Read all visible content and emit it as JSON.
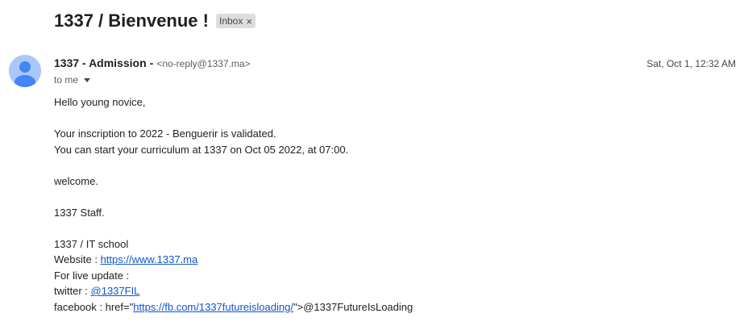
{
  "email": {
    "subject": "1337 / Bienvenue !",
    "label_chip": "Inbox",
    "label_chip_close": "×",
    "sender_name": "1337 - Admission",
    "sender_separator": "-",
    "sender_email": "<no-reply@1337.ma>",
    "timestamp": "Sat, Oct 1, 12:32 AM",
    "recipient": "to me",
    "body": {
      "greeting": "Hello young novice,",
      "validation": "Your inscription to 2022 - Benguerir is validated.",
      "start_info": "You can start your curriculum at 1337 on Oct 05 2022, at 07:00.",
      "welcome": "welcome.",
      "signoff": "1337 Staff.",
      "org": "1337 / IT school",
      "website_label": "Website : ",
      "website_link": "https://www.1337.ma",
      "live_update": "For live update :",
      "twitter_label": "twitter : ",
      "twitter_link": "@1337FIL",
      "facebook_label": "facebook : href=\"",
      "facebook_link": "https://fb.com/1337futureisloading/",
      "facebook_suffix": "\">@1337FutureIsLoading"
    }
  },
  "colors": {
    "link": "#1155cc",
    "avatar_bg": "#a8c7fa",
    "avatar_fg": "#4285f4",
    "chip_bg": "#dddddd"
  },
  "icons": {
    "avatar": "person-avatar-icon",
    "recipient_toggle": "caret-down-icon",
    "chip_close": "close-icon"
  }
}
